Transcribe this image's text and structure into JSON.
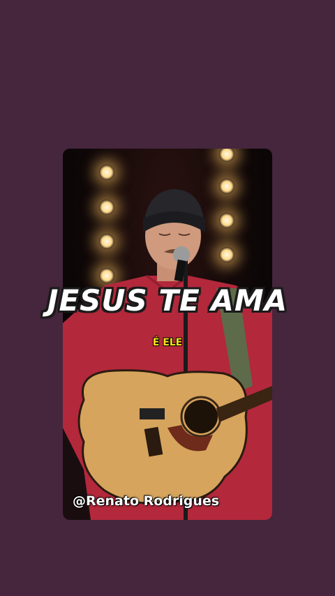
{
  "overlay": {
    "main_caption": "JESUS TE AMA",
    "sub_caption": "É ELE",
    "handle": "@Renato Rodrigues"
  },
  "colors": {
    "background": "#45263d",
    "caption_text": "#ffffff",
    "sub_caption_text": "#f6e11a",
    "shirt": "#b3283b"
  }
}
